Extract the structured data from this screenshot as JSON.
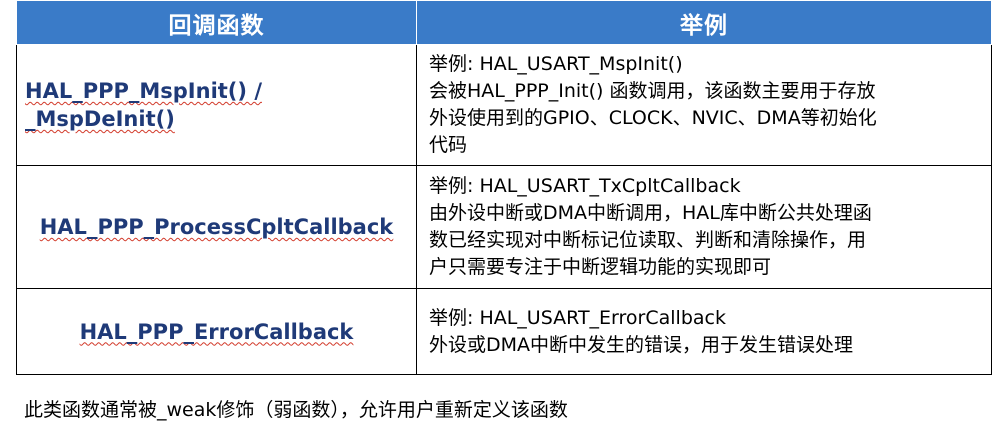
{
  "table": {
    "headers": [
      "回调函数",
      "举例"
    ],
    "rows": [
      {
        "function_lines": [
          "HAL_PPP_MspInit() /",
          "_MspDeInit()"
        ],
        "desc_lines": [
          "举例: HAL_USART_MspInit()",
          "会被HAL_PPP_Init() 函数调用，该函数主要用于存放",
          "外设使用到的GPIO、CLOCK、NVIC、DMA等初始化",
          "代码"
        ]
      },
      {
        "function_lines": [
          "HAL_PPP_ProcessCpltCallback"
        ],
        "desc_lines": [
          "举例: HAL_USART_TxCpltCallback",
          "由外设中断或DMA中断调用，HAL库中断公共处理函",
          "数已经实现对中断标记位读取、判断和清除操作，用",
          "户只需要专注于中断逻辑功能的实现即可"
        ]
      },
      {
        "function_lines": [
          "HAL_PPP_ErrorCallback"
        ],
        "desc_lines": [
          "举例: HAL_USART_ErrorCallback",
          "外设或DMA中断中发生的错误，用于发生错误处理"
        ]
      }
    ]
  },
  "caption": "此类函数通常被_weak修饰（弱函数），允许用户重新定义该函数",
  "colors": {
    "header_bg": "#3a7bc8",
    "function_text": "#1f3a78",
    "border": "#000000",
    "squiggle": "#d23a2a"
  }
}
